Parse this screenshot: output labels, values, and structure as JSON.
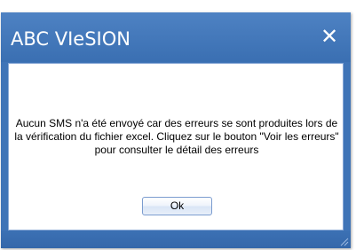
{
  "dialog": {
    "title": "ABC VIeSION",
    "close_glyph": "✕",
    "message": "Aucun SMS n'a été envoyé car des erreurs se sont produites lors de la vérification du fichier excel. Cliquez sur le bouton \"Voir les erreurs\" pour consulter le détail des erreurs",
    "ok_label": "Ok"
  },
  "colors": {
    "titlebar": "#3f74b7",
    "content_background": "#ffffff"
  },
  "icons": {
    "close": "close-icon",
    "resize_grip": "resize-grip-icon"
  }
}
